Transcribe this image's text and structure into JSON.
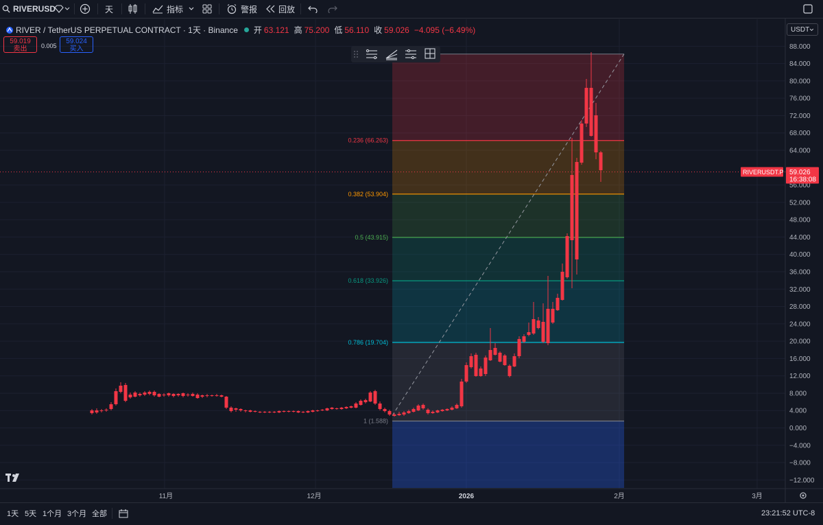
{
  "toolbar": {
    "symbol": "RIVERUSD",
    "interval": "天",
    "indicators_label": "指标",
    "alert_label": "警报",
    "replay_label": "回放"
  },
  "legend": {
    "title": "RIVER / TetherUS PERPETUAL CONTRACT · 1天 · Binance",
    "open_label": "开",
    "open": "63.121",
    "high_label": "高",
    "high": "75.200",
    "low_label": "低",
    "low": "56.110",
    "close_label": "收",
    "close": "59.026",
    "change": "−4.095 (−6.49%)"
  },
  "trade": {
    "sell_price": "59.019",
    "sell_label": "卖出",
    "spread": "0.005",
    "buy_price": "59.024",
    "buy_label": "买入"
  },
  "currency": "USDT",
  "price_axis": {
    "ticks": [
      "88.000",
      "84.000",
      "80.000",
      "76.000",
      "72.000",
      "68.000",
      "64.000",
      "56.000",
      "52.000",
      "48.000",
      "44.000",
      "40.000",
      "36.000",
      "32.000",
      "28.000",
      "24.000",
      "20.000",
      "16.000",
      "12.000",
      "8.000",
      "4.000",
      "0.000",
      "−4.000",
      "−8.000",
      "−12.000"
    ]
  },
  "current_price": {
    "symbol_label": "RIVERUSDT.P",
    "price": "59.026",
    "countdown": "16:38:08",
    "color": "#f23645"
  },
  "time_axis": {
    "labels": [
      {
        "text": "11月",
        "bold": false
      },
      {
        "text": "12月",
        "bold": false
      },
      {
        "text": "2026",
        "bold": true
      },
      {
        "text": "2月",
        "bold": false
      },
      {
        "text": "3月",
        "bold": false
      }
    ]
  },
  "fib_levels": [
    {
      "label": "0.236 (66.263)",
      "value": 66.263,
      "color": "#f23645"
    },
    {
      "label": "0.382 (53.904)",
      "value": 53.904,
      "color": "#ff9800"
    },
    {
      "label": "0.5 (43.915)",
      "value": 43.915,
      "color": "#4caf50"
    },
    {
      "label": "0.618 (33.926)",
      "value": 33.926,
      "color": "#089981"
    },
    {
      "label": "0.786 (19.704)",
      "value": 19.704,
      "color": "#00bcd4"
    },
    {
      "label": "1 (1.588)",
      "value": 1.588,
      "color": "#787b86"
    }
  ],
  "bottom": {
    "ranges": [
      "1天",
      "5天",
      "1个月",
      "3个月",
      "全部"
    ],
    "clock": "23:21:52 UTC-8"
  },
  "colors": {
    "up": "#26a69a",
    "down": "#f23645",
    "background": "#131722"
  }
}
